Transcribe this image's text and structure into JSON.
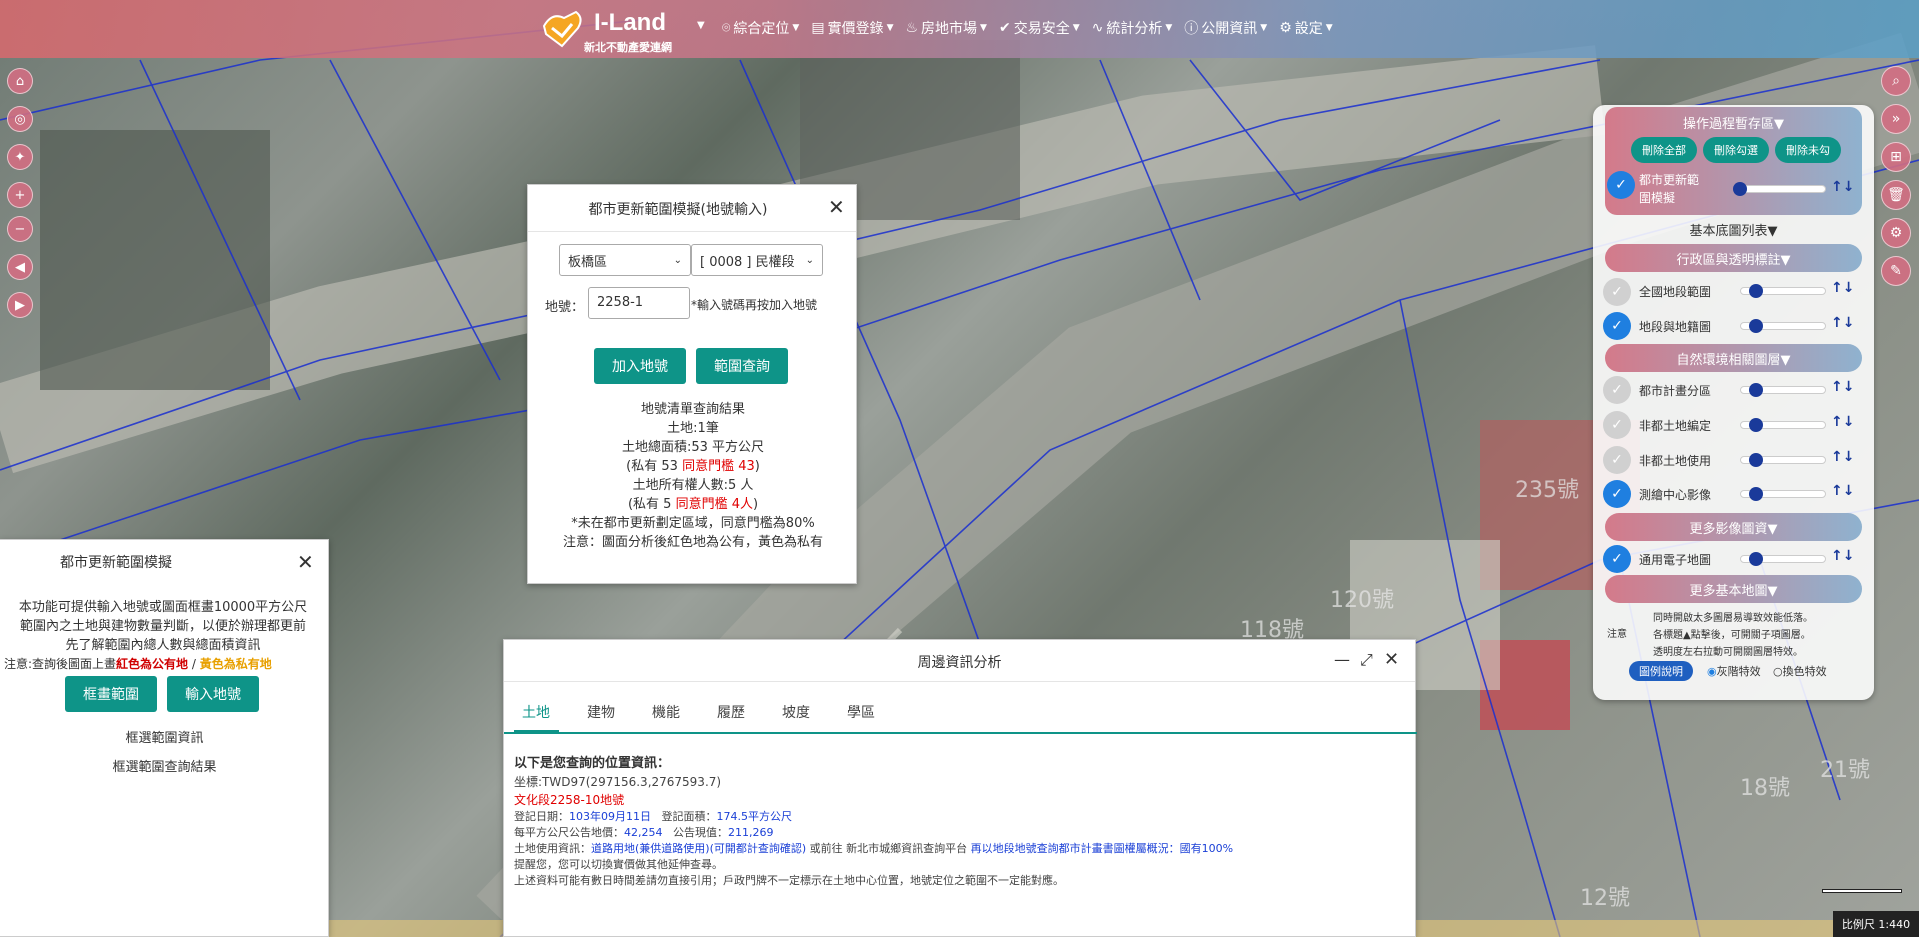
{
  "app": {
    "title": "I-Land",
    "subtitle": "新北不動產愛連網"
  },
  "menu": [
    {
      "label": "綜合定位",
      "icon": "location-pin-icon"
    },
    {
      "label": "實價登錄",
      "icon": "register-icon"
    },
    {
      "label": "房地市場",
      "icon": "fire-icon"
    },
    {
      "label": "交易安全",
      "icon": "check-circle-icon"
    },
    {
      "label": "統計分析",
      "icon": "pulse-icon"
    },
    {
      "label": "公開資訊",
      "icon": "info-icon"
    },
    {
      "label": "設定",
      "icon": "gear-icon"
    }
  ],
  "land_input_dialog": {
    "title": "都市更新範圍模擬(地號輸入)",
    "district": "板橋區",
    "section": "[ 0008 ] 民權段",
    "parcel_label": "地號：",
    "parcel_value": "2258-1",
    "parcel_hint": "*輸入號碼再按加入地號",
    "add_button": "加入地號",
    "query_button": "範圍查詢",
    "result": {
      "heading": "地號清單查詢結果",
      "land_count": "土地:1筆",
      "total_area": "土地總面積:53 平方公尺",
      "private_area_prefix": "(私有 53 ",
      "private_area_threshold": "同意門檻 43",
      "owners": "土地所有權人數:5 人",
      "private_owner_prefix": "(私有 5 ",
      "private_owner_threshold": "同意門檻 4人",
      "note1": "*未在都市更新劃定區域，同意門檻為80%",
      "note2": "注意：圖面分析後紅色地為公有，黃色為私有"
    }
  },
  "range_sim_dialog": {
    "title": "都市更新範圍模擬",
    "description": "本功能可提供輸入地號或圖面框畫10000平方公尺範圍內之土地與建物數量判斷，以便於辦理都更前先了解範圍內總人數與總面積資訊",
    "note_prefix": "注意:查詢後圖面上畫",
    "note_red": "紅色為公有地",
    "note_sep": " / ",
    "note_yellow": "黃色為私有地",
    "draw_button": "框畫範圍",
    "input_button": "輸入地號",
    "link1": "框選範圍資訊",
    "link2": "框選範圍查詢結果"
  },
  "surrounding_panel": {
    "title": "周邊資訊分析",
    "tabs": [
      "土地",
      "建物",
      "機能",
      "履歷",
      "坡度",
      "學區"
    ],
    "active_tab": "土地",
    "info": {
      "heading": "以下是您查詢的位置資訊：",
      "coord": "坐標:TWD97(297156.3,2767593.7)",
      "parcel": "文化段2258-10地號",
      "reg_date_label": "登記日期：",
      "reg_date": "103年09月11日",
      "reg_area_label": "登記面積：",
      "reg_area": "174.5平方公尺",
      "price_label": "每平方公尺公告地價：",
      "price": "42,254",
      "value_label": "公告現值：",
      "value": "211,269",
      "use_label": "土地使用資訊：",
      "use_value": "道路用地(兼供道路使用)(可開都計查詢確認)",
      "use_mid1": " 或前往 ",
      "use_platform": "新北市城鄉資訊查詢平台",
      "use_mid2": " 再以地段地號查詢都市計畫書圖權屬概況：",
      "use_public": "國有100%",
      "remind": "提醒您，您可以切換實價做其他延伸查尋。",
      "disclaimer": "上述資料可能有數日時間差請勿直接引用；戶政門牌不一定標示在土地中心位置，地號定位之範圍不一定能對應。"
    }
  },
  "layer_panel": {
    "buffer_title": "操作過程暫存區▼",
    "delete_all": "刪除全部",
    "delete_checked": "刪除勾選",
    "delete_unchecked": "刪除未勾",
    "buffer_layer": "都市更新範圍模擬",
    "basemap_list": "基本底圖列表▼",
    "group_admin": "行政區與透明標註▼",
    "layer_national": "全國地段範圍",
    "layer_cadastral": "地段與地籍圖",
    "group_nature": "自然環境相關圖層▼",
    "layer_zoning": "都市計畫分區",
    "layer_nonurban_code": "非都土地編定",
    "layer_nonurban_use": "非都土地使用",
    "layer_survey": "測繪中心影像",
    "group_imagery": "更多影像圖資▼",
    "layer_emap": "通用電子地圖",
    "group_basemap": "更多基本地圖▼",
    "note_label": "注意",
    "note1": "同時開啟太多圖層易導致效能低落。",
    "note2": "各標題▲點擊後，可開關子項圖層。",
    "note3": "透明度左右拉動可開關圖層特效。",
    "legend_button": "圖例說明",
    "radio_grayscale": "灰階特效",
    "radio_color": "換色特效"
  },
  "map": {
    "scale": "比例尺 1:440",
    "labels": [
      "235號",
      "120號",
      "118號",
      "18號",
      "21號",
      "12號"
    ]
  },
  "colors": {
    "teal": "#0e9488",
    "red": "#e00000",
    "blue": "#1a3fd6"
  }
}
